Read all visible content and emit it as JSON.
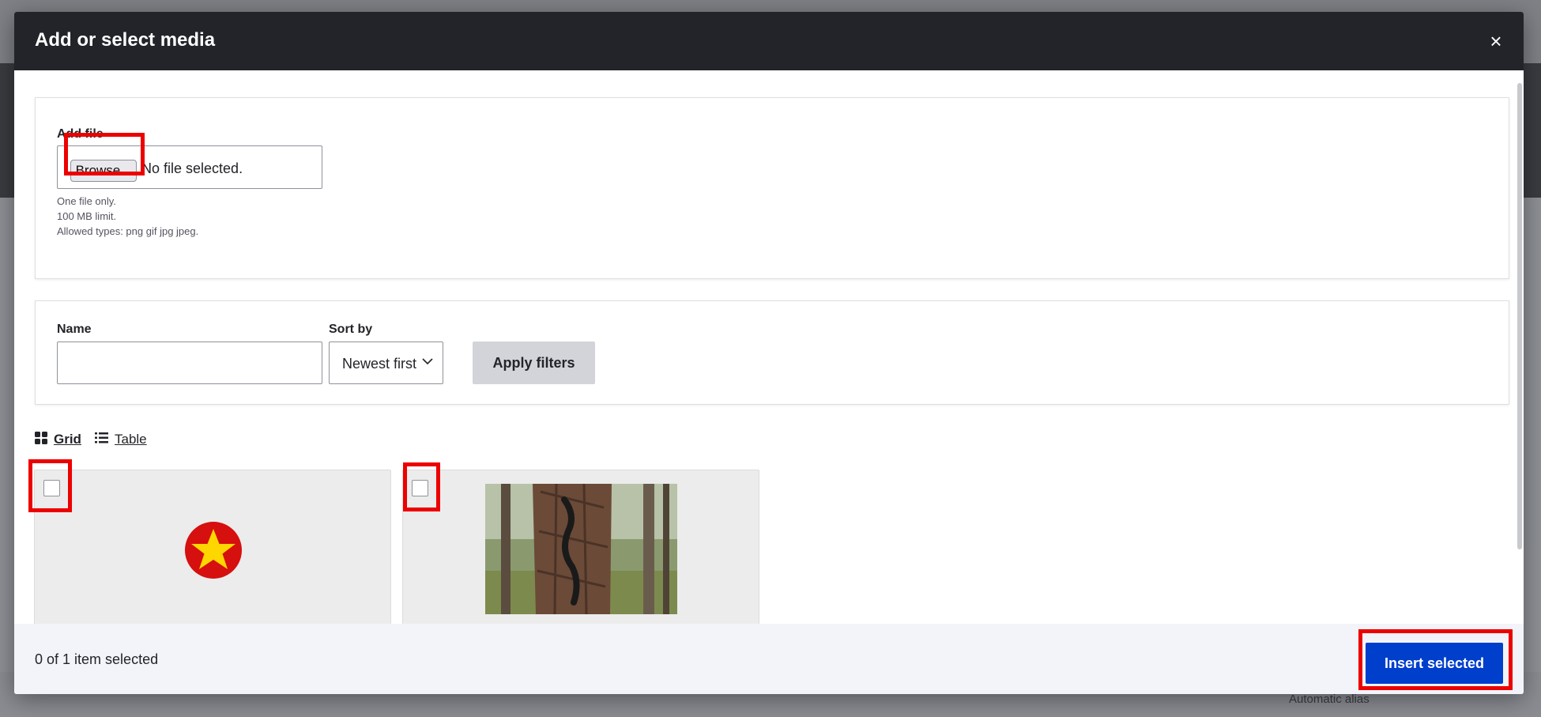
{
  "background": {
    "alias_text": "Automatic alias"
  },
  "dialog": {
    "title": "Add or select media",
    "close_label": "×"
  },
  "upload": {
    "label": "Add file",
    "browse_label": "Browse...",
    "file_status": "No file selected.",
    "hints": [
      "One file only.",
      "100 MB limit.",
      "Allowed types: png gif jpg jpeg."
    ]
  },
  "filters": {
    "name_label": "Name",
    "name_value": "",
    "sort_label": "Sort by",
    "sort_value": "Newest first",
    "apply_label": "Apply filters"
  },
  "views": {
    "grid_label": "Grid",
    "table_label": "Table"
  },
  "media": [
    {
      "thumb": "red-circle-yellow-star-icon",
      "checked": false
    },
    {
      "thumb": "snake-on-tree-photo",
      "checked": false
    }
  ],
  "footer": {
    "selection_status": "0 of 1 item selected",
    "insert_label": "Insert selected"
  },
  "colors": {
    "header_bg": "#232429",
    "primary_button": "#003ecc",
    "highlight": "#ec0000"
  }
}
